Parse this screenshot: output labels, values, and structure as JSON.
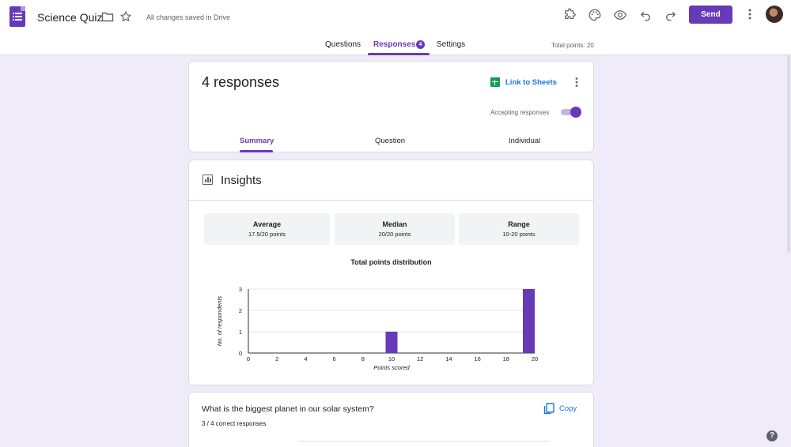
{
  "header": {
    "title": "Science Quiz",
    "saved_status": "All changes saved in Drive",
    "send_label": "Send",
    "icons": [
      "forms-logo-icon",
      "folder-icon",
      "star-icon",
      "puzzle-icon",
      "palette-icon",
      "preview-eye-icon",
      "undo-icon",
      "redo-icon",
      "more-vert-icon",
      "avatar"
    ]
  },
  "tabs": {
    "items": [
      {
        "label": "Questions"
      },
      {
        "label": "Responses",
        "badge": "4"
      },
      {
        "label": "Settings"
      }
    ],
    "active": "Responses",
    "total_points": "Total points: 20"
  },
  "responses_card": {
    "count_label": "4 responses",
    "link_sheets": "Link to Sheets",
    "accepting_label": "Accepting responses",
    "accepting_on": true,
    "subtabs": [
      {
        "label": "Summary"
      },
      {
        "label": "Question"
      },
      {
        "label": "Individual"
      }
    ],
    "active_subtab": "Summary"
  },
  "insights": {
    "title": "Insights",
    "stats": [
      {
        "label": "Average",
        "value": "17.5/20 points"
      },
      {
        "label": "Median",
        "value": "20/20 points"
      },
      {
        "label": "Range",
        "value": "10-20 points"
      }
    ]
  },
  "chart_data": {
    "type": "bar",
    "title": "Total points distribution",
    "xlabel": "Points scored",
    "ylabel": "No. of respondents",
    "x": [
      0,
      2,
      4,
      6,
      8,
      10,
      12,
      14,
      16,
      18,
      20
    ],
    "x_ticks": [
      "0",
      "2",
      "4",
      "6",
      "8",
      "10",
      "12",
      "14",
      "16",
      "18",
      "20"
    ],
    "values": [
      0,
      0,
      0,
      0,
      0,
      1,
      0,
      0,
      0,
      0,
      3
    ],
    "y_ticks": [
      "0",
      "1",
      "2",
      "3"
    ],
    "xlim": [
      0,
      20
    ],
    "ylim": [
      0,
      3
    ],
    "bar_color": "#673ab7",
    "grid": true
  },
  "question_card": {
    "question": "What is the biggest planet in our solar system?",
    "copy_label": "Copy",
    "correct": "3 / 4 correct responses"
  },
  "colors": {
    "accent": "#673ab7",
    "background": "#f0ebf8",
    "link": "#1a73e8"
  },
  "help_label": "?"
}
